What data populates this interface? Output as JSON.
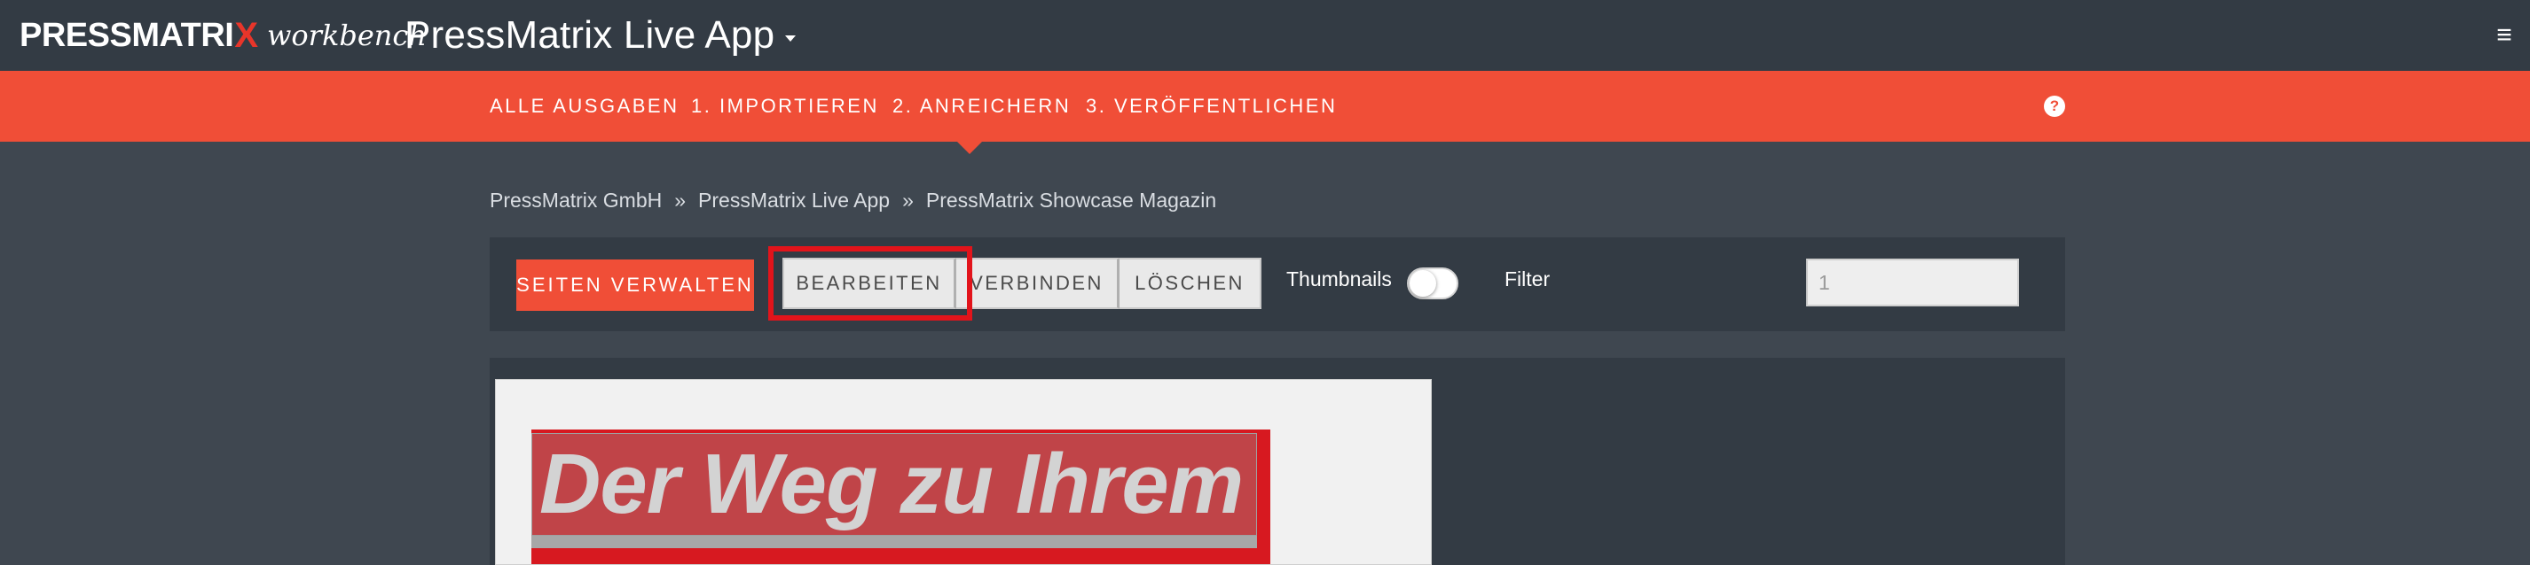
{
  "brand": {
    "logo_main": "PRESSMATRI",
    "logo_x": "X",
    "logo_sub": "workbench"
  },
  "header": {
    "app_title": "PressMatrix Live App",
    "menu_icon": "hamburger-icon"
  },
  "nav": {
    "items": [
      {
        "label": "ALLE AUSGABEN"
      },
      {
        "label": "1. IMPORTIEREN"
      },
      {
        "label": "2. ANREICHERN"
      },
      {
        "label": "3. VERÖFFENTLICHEN"
      }
    ],
    "active_index": 2,
    "help_icon": "question-circle-icon",
    "help_glyph": "?"
  },
  "breadcrumb": {
    "items": [
      "PressMatrix GmbH",
      "PressMatrix Live App",
      "PressMatrix Showcase Magazin"
    ],
    "separator": "»"
  },
  "toolbar": {
    "manage_label": "SEITEN VERWALTEN",
    "edit_label": "BEARBEITEN",
    "connect_label": "VERBINDEN",
    "delete_label": "LÖSCHEN",
    "thumbnails_label": "Thumbnails",
    "thumbnails_on": false,
    "filter_label": "Filter",
    "filter_value": "1"
  },
  "page_preview": {
    "headline": "Der Weg zu Ihrem"
  },
  "colors": {
    "accent": "#f04e37",
    "topbar": "#333b44",
    "background": "#3f4750",
    "highlight": "#e2141b"
  }
}
